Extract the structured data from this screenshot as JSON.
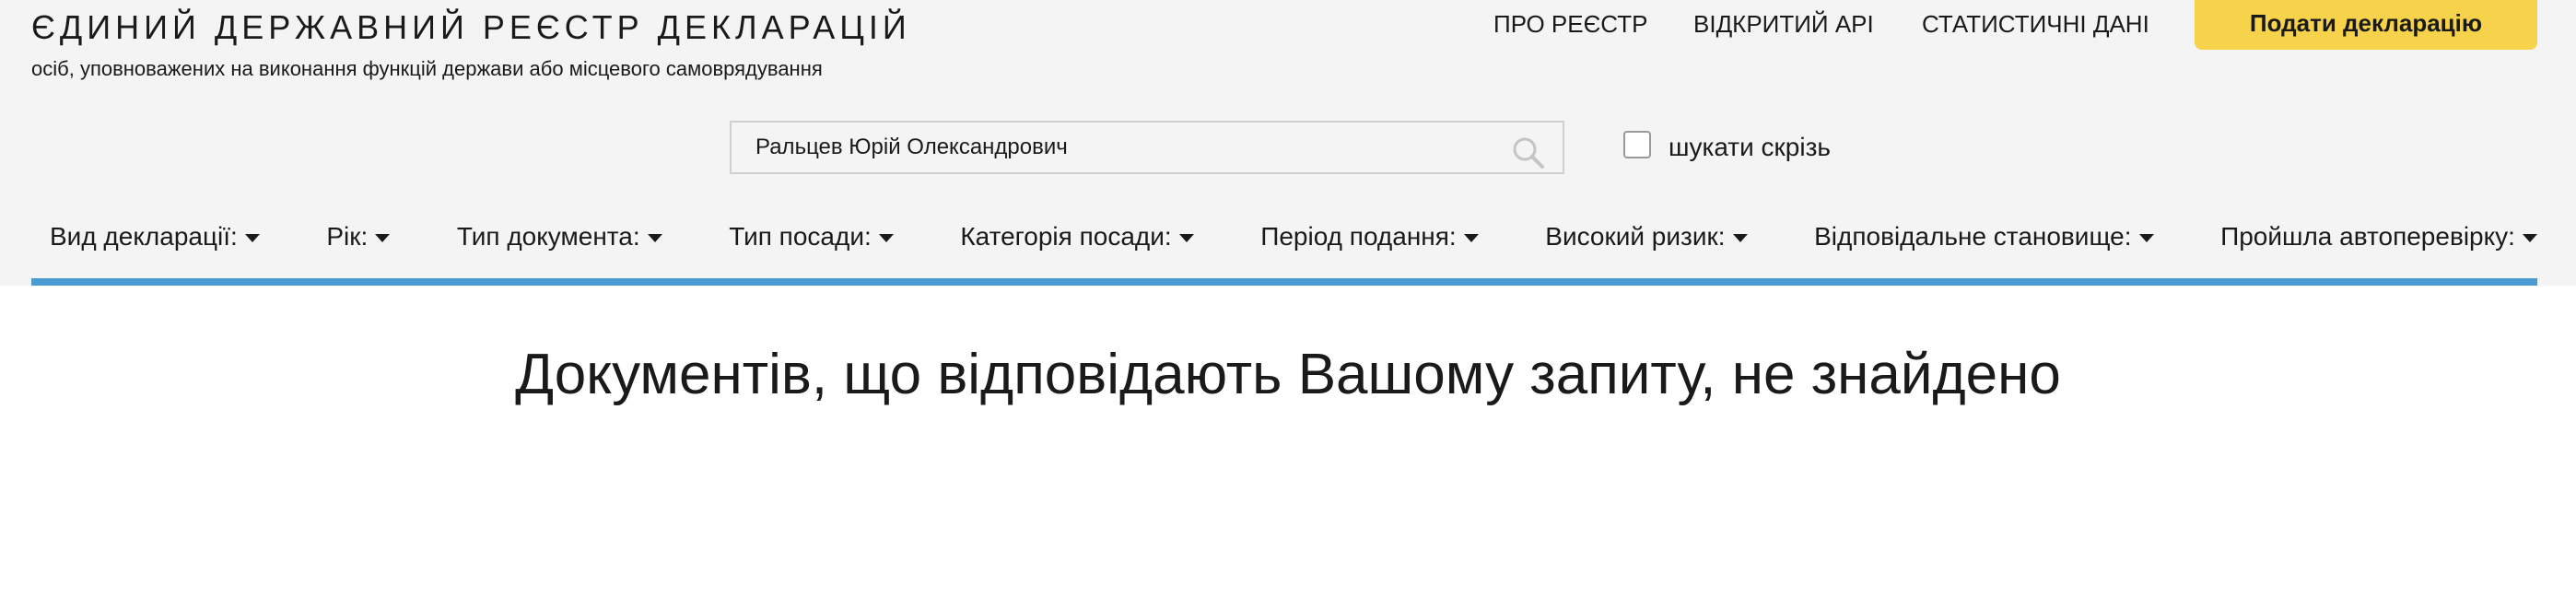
{
  "header": {
    "title": "ЄДИНИЙ ДЕРЖАВНИЙ РЕЄСТР ДЕКЛАРАЦІЙ",
    "subtitle": "осіб, уповноважених на виконання функцій держави або місцевого самоврядування",
    "nav": [
      {
        "label": "ПРО РЕЄСТР"
      },
      {
        "label": "ВІДКРИТИЙ API"
      },
      {
        "label": "СТАТИСТИЧНІ ДАНІ"
      }
    ],
    "submit_label": "Подати декларацію"
  },
  "search": {
    "value": "Ральцев Юрій Олександрович",
    "icon": "search-icon",
    "everywhere_label": "шукати скрізь",
    "everywhere_checked": false
  },
  "filters": [
    {
      "label": "Вид декларації:"
    },
    {
      "label": "Рік:"
    },
    {
      "label": "Тип документа:"
    },
    {
      "label": "Тип посади:"
    },
    {
      "label": "Категорія посади:"
    },
    {
      "label": "Період подання:"
    },
    {
      "label": "Високий ризик:"
    },
    {
      "label": "Відповідальне становище:"
    },
    {
      "label": "Пройшла автоперевірку:"
    }
  ],
  "colors": {
    "accent_bar": "#4a9ad4",
    "submit_button": "#f6d34a",
    "header_bg": "#f4f4f4"
  },
  "results": {
    "message": "Документів, що відповідають Вашому запиту, не знайдено"
  }
}
